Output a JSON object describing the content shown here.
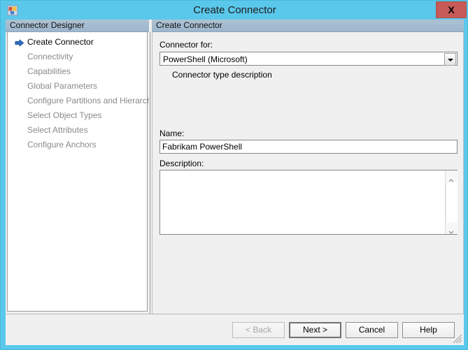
{
  "window": {
    "title": "Create Connector",
    "icon": "app-tiles-icon",
    "close_label": "X",
    "frame_color": "#5ac8eb",
    "close_color": "#c75b57"
  },
  "left_pane": {
    "header": "Connector Designer",
    "items": [
      {
        "label": "Create Connector",
        "active": true,
        "icon": "blue-right-arrow-icon"
      },
      {
        "label": "Connectivity",
        "active": false
      },
      {
        "label": "Capabilities",
        "active": false
      },
      {
        "label": "Global Parameters",
        "active": false
      },
      {
        "label": "Configure Partitions and Hierarchies",
        "active": false
      },
      {
        "label": "Select Object Types",
        "active": false
      },
      {
        "label": "Select Attributes",
        "active": false
      },
      {
        "label": "Configure Anchors",
        "active": false
      }
    ]
  },
  "right_pane": {
    "header": "Create Connector",
    "connector_for": {
      "label": "Connector for:",
      "value": "PowerShell (Microsoft)",
      "options": [
        "PowerShell (Microsoft)"
      ]
    },
    "type_description": "Connector type description",
    "name": {
      "label": "Name:",
      "value": "Fabrikam PowerShell",
      "placeholder": ""
    },
    "description": {
      "label": "Description:",
      "value": "",
      "placeholder": ""
    }
  },
  "buttons": {
    "back": "<  Back",
    "next": "Next  >",
    "cancel": "Cancel",
    "help": "Help"
  }
}
